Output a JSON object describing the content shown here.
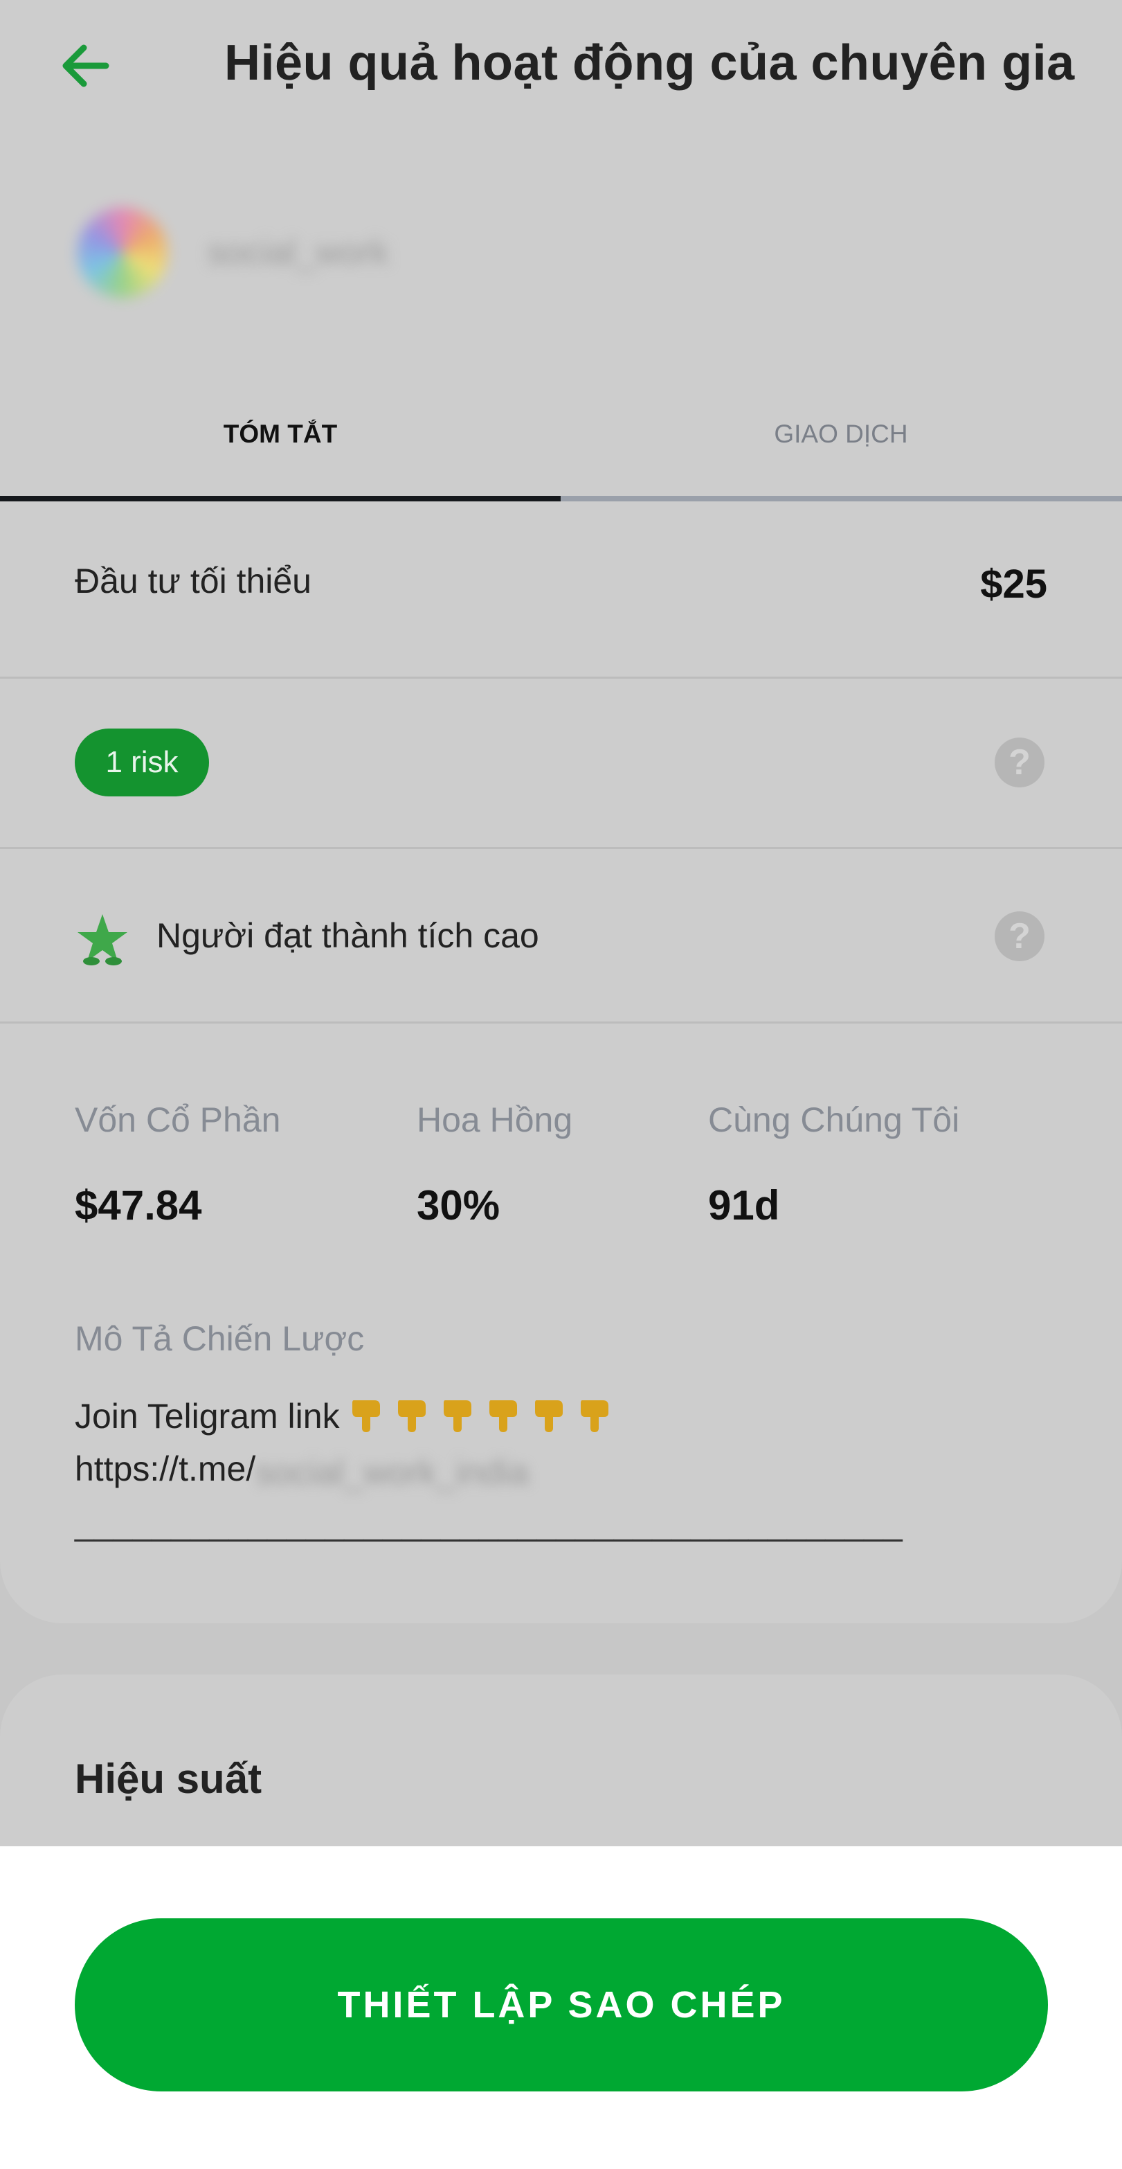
{
  "header": {
    "title": "Hiệu quả hoạt động của chuyên gia",
    "back_icon": "arrow-left-icon",
    "accent": "#1a9a3a"
  },
  "profile": {
    "name": "social_work"
  },
  "tabs": [
    {
      "label": "TÓM TẮT",
      "active": true
    },
    {
      "label": "GIAO DỊCH",
      "active": false
    }
  ],
  "summary": {
    "min_investment": {
      "label": "Đầu tư tối thiểu",
      "value": "$25"
    },
    "risk": {
      "label": "1 risk",
      "color": "#14932f"
    },
    "achievement": {
      "label": "Người đạt thành tích cao",
      "icon": "star-achiever-icon"
    },
    "stats": [
      {
        "label": "Vốn Cổ Phần",
        "value": "$47.84"
      },
      {
        "label": "Hoa Hồng",
        "value": "30%"
      },
      {
        "label": "Cùng Chúng Tôi",
        "value": "91d"
      }
    ],
    "description": {
      "label": "Mô Tả Chiến Lược",
      "line1": "Join Teligram link",
      "emoji_count": 6,
      "link_prefix": "https://t.me/",
      "link_handle": "social_work_india",
      "separator": "___________________________________________"
    }
  },
  "performance": {
    "title": "Hiệu suất"
  },
  "cta": {
    "label": "THIẾT LẬP SAO CHÉP",
    "color": "#00a832"
  }
}
